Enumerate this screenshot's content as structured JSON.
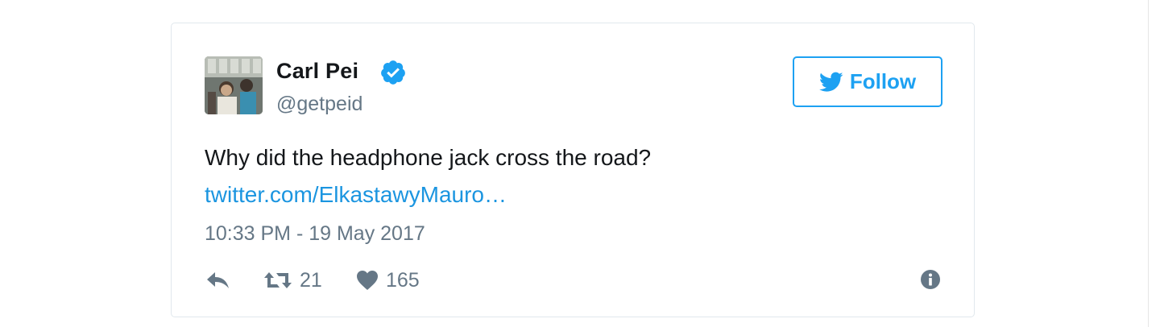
{
  "tweet": {
    "author_name": "Carl Pei",
    "author_handle": "@getpeid",
    "verified": true,
    "text": "Why did the headphone jack cross the road?",
    "link_text": "twitter.com/ElkastawyMauro…",
    "timestamp": "10:33 PM - 19 May 2017",
    "follow_label": "Follow",
    "retweet_count": "21",
    "like_count": "165"
  },
  "icons": {
    "avatar": "profile-photo",
    "verified": "verified-badge-icon",
    "follow": "twitter-bird-icon",
    "reply": "reply-arrow-icon",
    "retweet": "retweet-icon",
    "like": "heart-icon",
    "info": "info-icon"
  },
  "colors": {
    "accent": "#1da1f2",
    "link": "#1b95e0",
    "text": "#14171a",
    "muted": "#657786",
    "border": "#e1e8ed"
  }
}
